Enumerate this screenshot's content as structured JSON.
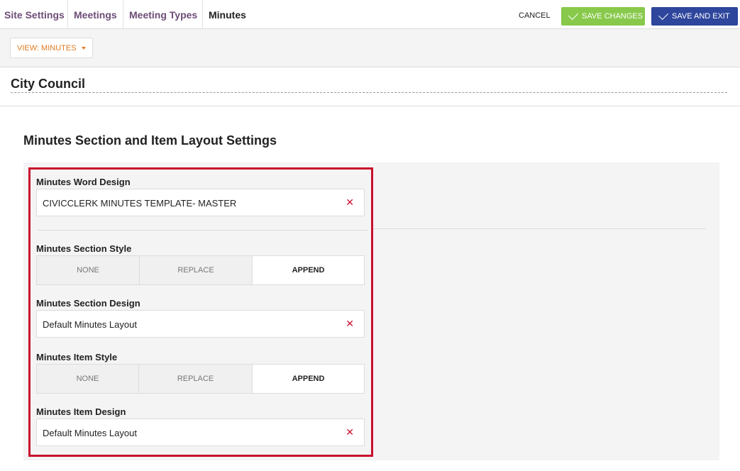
{
  "nav": {
    "tabs": [
      {
        "label": "Site Settings"
      },
      {
        "label": "Meetings"
      },
      {
        "label": "Meeting Types"
      },
      {
        "label": "Minutes"
      }
    ],
    "active_tab": "Minutes",
    "cancel_label": "CANCEL",
    "save_label": "SAVE CHANGES",
    "save_exit_label": "SAVE AND EXIT"
  },
  "toolbar": {
    "view_label": "VIEW: MINUTES"
  },
  "city": {
    "name": "City Council"
  },
  "section": {
    "title": "Minutes Section and Item Layout Settings",
    "word_design": {
      "label": "Minutes Word Design",
      "value": "CIVICCLERK MINUTES TEMPLATE- MASTER"
    },
    "section_style": {
      "label": "Minutes Section Style",
      "options": [
        "NONE",
        "REPLACE",
        "APPEND"
      ],
      "selected": "APPEND"
    },
    "section_design": {
      "label": "Minutes Section Design",
      "value": "Default Minutes Layout"
    },
    "item_style": {
      "label": "Minutes Item Style",
      "options": [
        "NONE",
        "REPLACE",
        "APPEND"
      ],
      "selected": "APPEND"
    },
    "item_design": {
      "label": "Minutes Item Design",
      "value": "Default Minutes Layout"
    },
    "clear_glyph": "✕"
  },
  "colors": {
    "tab_text": "#6d4e77",
    "save_green": "#88c94b",
    "save_exit_blue": "#2e469c",
    "view_orange": "#e07b22",
    "highlight_red": "#c8102e"
  }
}
